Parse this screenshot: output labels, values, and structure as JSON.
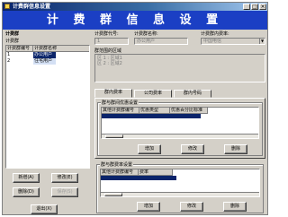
{
  "window": {
    "title": "计费群信息设置",
    "banner": "计 费 群 信 息 设 置",
    "controls": {
      "minimize": "_",
      "maximize": "□",
      "close": "×"
    }
  },
  "left": {
    "group_label": "计费群",
    "list_label": "计费群",
    "columns": [
      "计费群编号",
      "计费群名称"
    ],
    "rows": [
      {
        "id": "1",
        "name": "办公用户",
        "selected": true
      },
      {
        "id": "2",
        "name": "住宅用户",
        "selected": false
      }
    ],
    "buttons": {
      "add": "新增(A)",
      "edit": "修改(E)",
      "delete": "删除(D)",
      "save": "保存(S)",
      "exit": "退出(X)"
    }
  },
  "form": {
    "code_label": "计费群代号:",
    "code_value": "1",
    "name_label": "计费群名称:",
    "name_value": "办公用户",
    "type_label": "计费群内费率:",
    "type_value": "中国电信",
    "region_label": "群范围的区域",
    "region_lines": [
      "区 1 : 区域1",
      "区 2 : 区域2"
    ]
  },
  "tabs": [
    "群内费率",
    "公司费率",
    "群内号码"
  ],
  "active_tab": 0,
  "panel1": {
    "title": "群与群间优惠设置",
    "columns": [
      "其他计费群编号",
      "优惠类型",
      "优惠百分比标准"
    ],
    "buttons": {
      "add": "增加",
      "edit": "修改",
      "delete": "删除"
    }
  },
  "panel2": {
    "title": "群与群费率设置",
    "columns": [
      "其他计费群编号",
      "费率"
    ],
    "buttons": {
      "add": "增加",
      "edit": "修改",
      "delete": "删除"
    }
  },
  "colors": {
    "title_bar": "#0a246a",
    "banner": "#1b3fc4",
    "selection": "#0a246a",
    "face": "#d4d0c8"
  }
}
